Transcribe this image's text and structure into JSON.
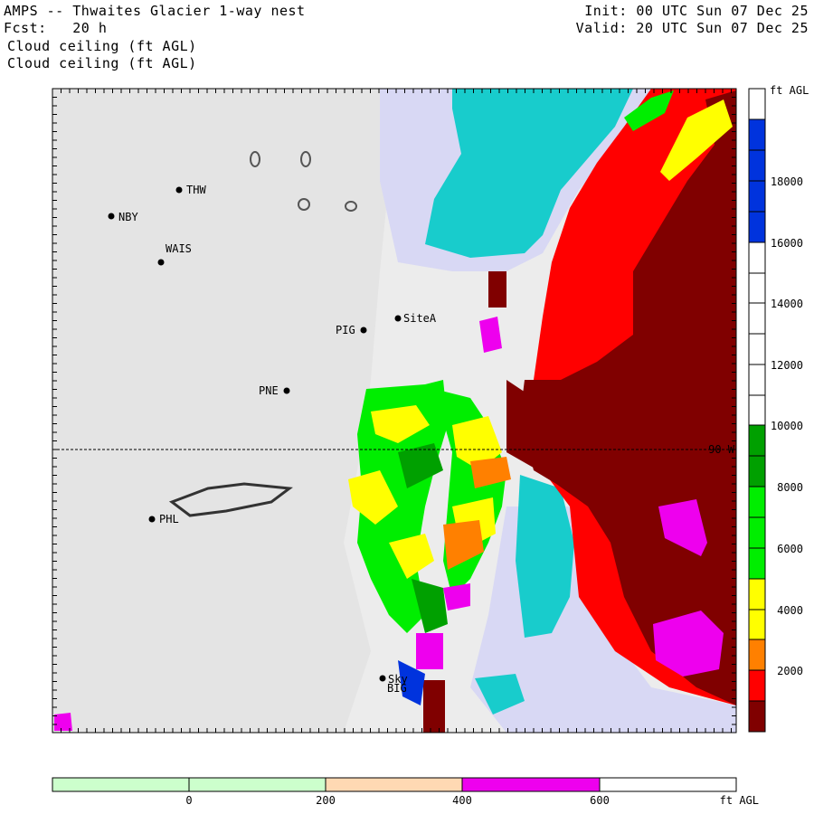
{
  "header": {
    "title": "AMPS -- Thwaites Glacier 1-way nest",
    "fcst": "Fcst:   20 h",
    "field1": "Cloud ceiling (ft AGL)",
    "field2": "Cloud ceiling (ft AGL)",
    "init": "Init: 00 UTC Sun 07 Dec 25",
    "valid": "Valid: 20 UTC Sun 07 Dec 25"
  },
  "stations": [
    {
      "name": "THW"
    },
    {
      "name": "NBY"
    },
    {
      "name": "WAIS"
    },
    {
      "name": "SiteA"
    },
    {
      "name": "PIG"
    },
    {
      "name": "PNE"
    },
    {
      "name": "PHL"
    },
    {
      "name": "Sky"
    },
    {
      "name": "BIG"
    }
  ],
  "meridian_label": "90 W",
  "colorbar_right": {
    "unit": "ft AGL",
    "ticks": [
      "18000",
      "16000",
      "14000",
      "12000",
      "10000",
      "8000",
      "6000",
      "4000",
      "2000"
    ],
    "colors": {
      "above_18000": "#ffffff",
      "blue": "#0033dd",
      "green_dark": "#00a000",
      "green": "#00ee00",
      "yellow": "#ffff00",
      "orange": "#ff8000",
      "red": "#ff0000",
      "maroon": "#800000"
    }
  },
  "colorbar_bottom": {
    "unit": "ft AGL",
    "ticks": [
      "0",
      "200",
      "400",
      "600"
    ],
    "colors": [
      "#ccffcc",
      "#ccffcc",
      "#ffd9b3",
      "#ee00ee",
      "#ffffff"
    ]
  }
}
